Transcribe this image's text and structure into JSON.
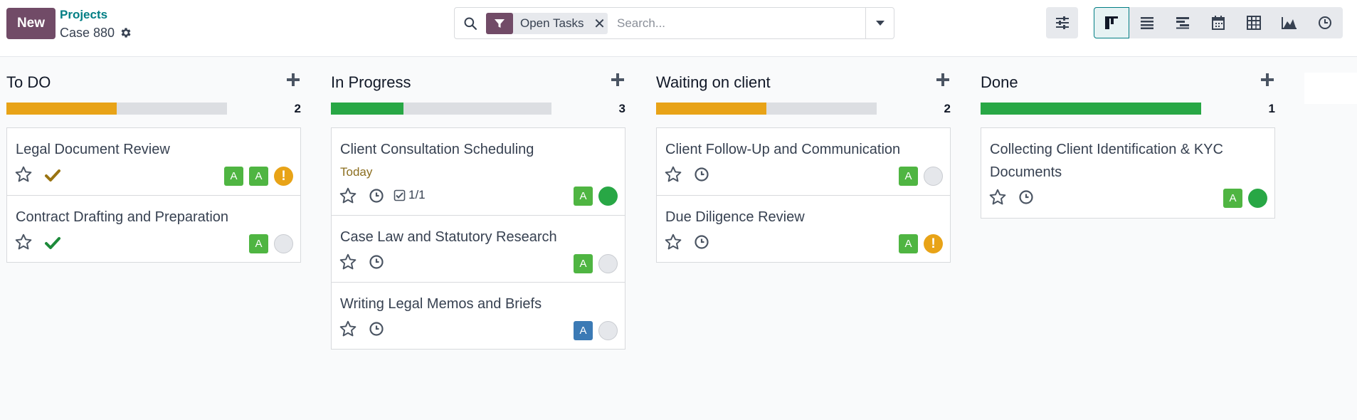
{
  "control": {
    "new_label": "New",
    "breadcrumb_parent": "Projects",
    "breadcrumb_current": "Case 880",
    "facet_label": "Open Tasks",
    "facet_remove": "✕",
    "search_placeholder": "Search..."
  },
  "colors": {
    "brand": "#714b67",
    "link": "#017e84",
    "orange": "#e8a317",
    "green": "#28a745",
    "avatar_green": "#4fb542",
    "avatar_blue": "#3b7ab5"
  },
  "view_icons": [
    "kanban-icon",
    "list-icon",
    "gantt-icon",
    "calendar-icon",
    "pivot-icon",
    "graph-icon",
    "activity-icon"
  ],
  "columns": [
    {
      "title": "To DO",
      "count": "2",
      "progress": 0.5,
      "progress_color": "orange",
      "cards": [
        {
          "title": "Legal Document Review",
          "check": "approved",
          "avatars": [
            "A",
            "A"
          ],
          "status": "blocked"
        },
        {
          "title": "Contract Drafting and Preparation",
          "check": "done",
          "avatars": [
            "A"
          ],
          "status": "normal"
        }
      ]
    },
    {
      "title": "In Progress",
      "count": "3",
      "progress": 0.33,
      "progress_color": "green",
      "cards": [
        {
          "title": "Client Consultation Scheduling",
          "date": "Today",
          "subtasks": "1/1",
          "avatars": [
            "A"
          ],
          "status": "done"
        },
        {
          "title": "Case Law and Statutory Research",
          "avatars": [
            "A"
          ],
          "status": "normal"
        },
        {
          "title": "Writing Legal Memos and Briefs",
          "avatars": [
            "A"
          ],
          "avatar_color": "blue",
          "status": "normal"
        }
      ]
    },
    {
      "title": "Waiting on client",
      "count": "2",
      "progress": 0.5,
      "progress_color": "orange",
      "cards": [
        {
          "title": "Client Follow-Up and Communication",
          "avatars": [
            "A"
          ],
          "status": "normal"
        },
        {
          "title": "Due Diligence Review",
          "avatars": [
            "A"
          ],
          "status": "blocked"
        }
      ]
    },
    {
      "title": "Done",
      "count": "1",
      "progress": 1,
      "progress_color": "green",
      "cards": [
        {
          "title": "Collecting Client Identification & KYC Documents",
          "avatars": [
            "A"
          ],
          "status": "done"
        }
      ]
    }
  ]
}
